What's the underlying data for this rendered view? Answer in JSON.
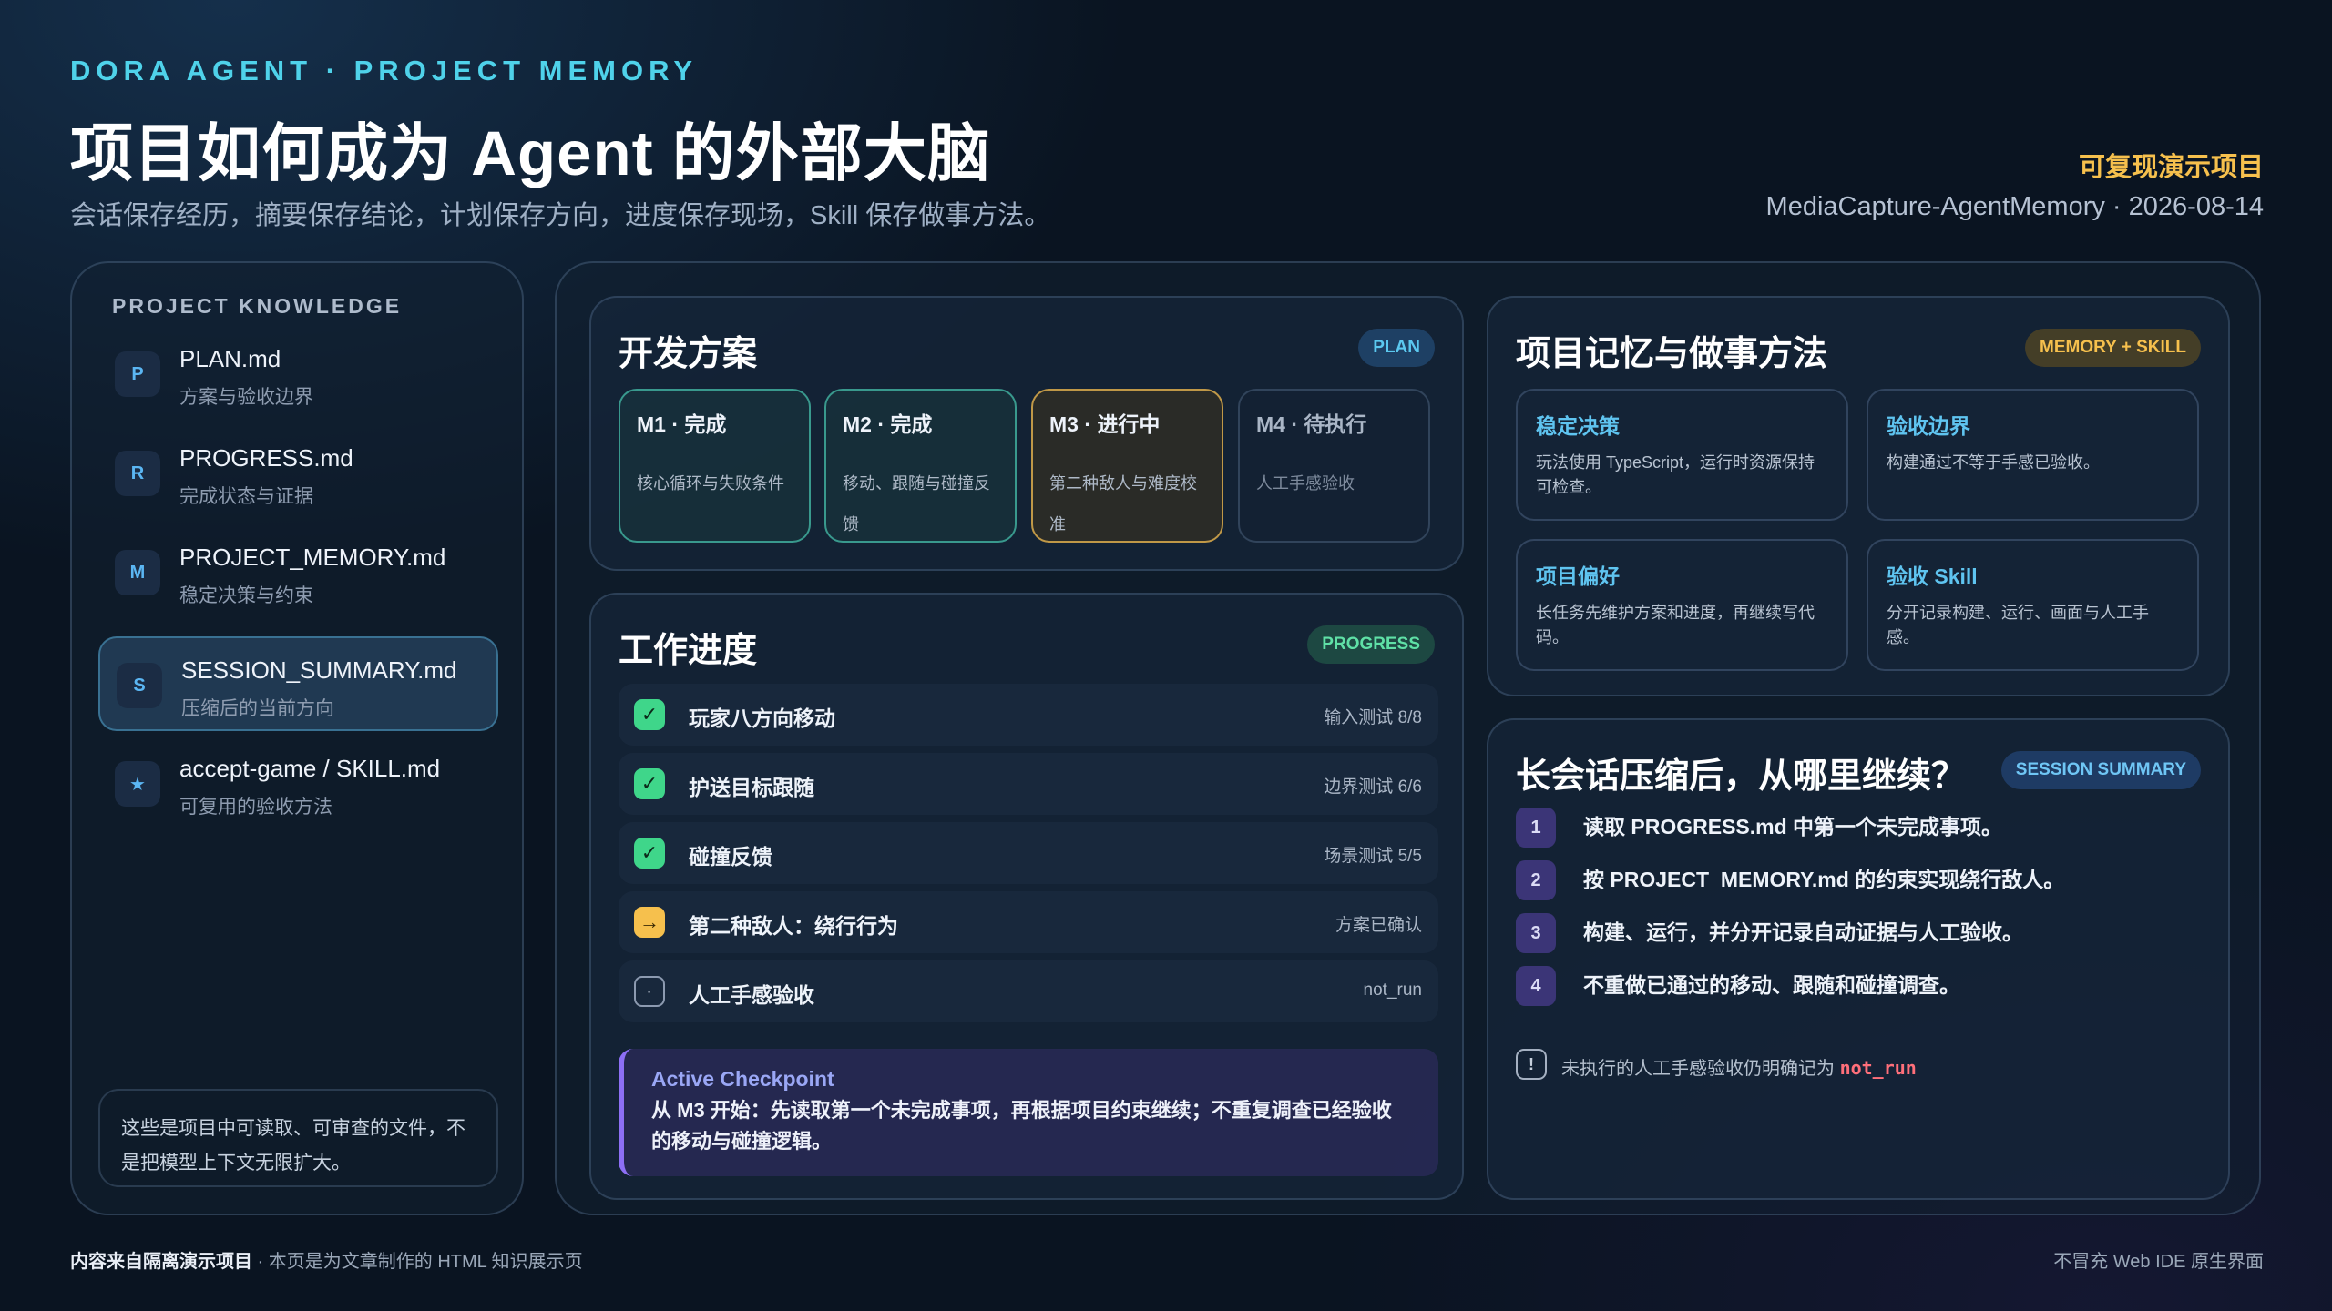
{
  "header": {
    "eyebrow": "DORA AGENT · PROJECT MEMORY",
    "title": "项目如何成为 Agent 的外部大脑",
    "subtitle": "会话保存经历，摘要保存结论，计划保存方向，进度保存现场，Skill 保存做事方法。",
    "badge": "可复现演示项目",
    "meta": "MediaCapture-AgentMemory · 2026-08-14"
  },
  "sidebar": {
    "title": "PROJECT KNOWLEDGE",
    "files": [
      {
        "icon": "P",
        "name": "PLAN.md",
        "desc": "方案与验收边界"
      },
      {
        "icon": "R",
        "name": "PROGRESS.md",
        "desc": "完成状态与证据"
      },
      {
        "icon": "M",
        "name": "PROJECT_MEMORY.md",
        "desc": "稳定决策与约束"
      },
      {
        "icon": "S",
        "name": "SESSION_SUMMARY.md",
        "desc": "压缩后的当前方向"
      },
      {
        "icon": "★",
        "name": "accept-game / SKILL.md",
        "desc": "可复用的验收方法"
      }
    ],
    "note": "这些是项目中可读取、可审查的文件，不是把模型上下文无限扩大。"
  },
  "plan": {
    "title": "开发方案",
    "pill": "PLAN",
    "milestones": [
      {
        "title": "M1 · 完成",
        "desc": "核心循环与失败条件",
        "status": "done"
      },
      {
        "title": "M2 · 完成",
        "desc": "移动、跟随与碰撞反馈",
        "status": "done"
      },
      {
        "title": "M3 · 进行中",
        "desc": "第二种敌人与难度校准",
        "status": "in_progress"
      },
      {
        "title": "M4 · 待执行",
        "desc": "人工手感验收",
        "status": "todo"
      }
    ]
  },
  "progress": {
    "title": "工作进度",
    "pill": "PROGRESS",
    "tasks": [
      {
        "icon": "✓",
        "label": "玩家八方向移动",
        "status": "输入测试 8/8",
        "state": "done"
      },
      {
        "icon": "✓",
        "label": "护送目标跟随",
        "status": "边界测试 6/6",
        "state": "done"
      },
      {
        "icon": "✓",
        "label": "碰撞反馈",
        "status": "场景测试 5/5",
        "state": "done"
      },
      {
        "icon": "→",
        "label": "第二种敌人：绕行行为",
        "status": "方案已确认",
        "state": "doing"
      },
      {
        "icon": "·",
        "label": "人工手感验收",
        "status": "not_run",
        "state": "todo"
      }
    ],
    "checkpoint": {
      "title": "Active Checkpoint",
      "text": "从 M3 开始：先读取第一个未完成事项，再根据项目约束继续；不重复调查已经验收的移动与碰撞逻辑。"
    }
  },
  "memory": {
    "title": "项目记忆与做事方法",
    "pill": "MEMORY + SKILL",
    "items": [
      {
        "title": "稳定决策",
        "desc": "玩法使用 TypeScript，运行时资源保持可检查。"
      },
      {
        "title": "验收边界",
        "desc": "构建通过不等于手感已验收。"
      },
      {
        "title": "项目偏好",
        "desc": "长任务先维护方案和进度，再继续写代码。"
      },
      {
        "title": "验收 Skill",
        "desc": "分开记录构建、运行、画面与人工手感。"
      }
    ]
  },
  "session": {
    "title": "长会话压缩后，从哪里继续？",
    "pill": "SESSION SUMMARY",
    "steps": [
      {
        "num": "1",
        "text": "读取 PROGRESS.md 中第一个未完成事项。"
      },
      {
        "num": "2",
        "text": "按 PROJECT_MEMORY.md 的约束实现绕行敌人。"
      },
      {
        "num": "3",
        "text": "构建、运行，并分开记录自动证据与人工验收。"
      },
      {
        "num": "4",
        "text": "不重做已通过的移动、跟随和碰撞调查。"
      }
    ],
    "note_icon": "!",
    "note_text": "未执行的人工手感验收仍明确记为",
    "note_code": "not_run"
  },
  "footer": {
    "left_bold": "内容来自隔离演示项目",
    "left_rest": " · 本页是为文章制作的 HTML 知识展示页",
    "right": "不冒充 Web IDE 原生界面"
  }
}
